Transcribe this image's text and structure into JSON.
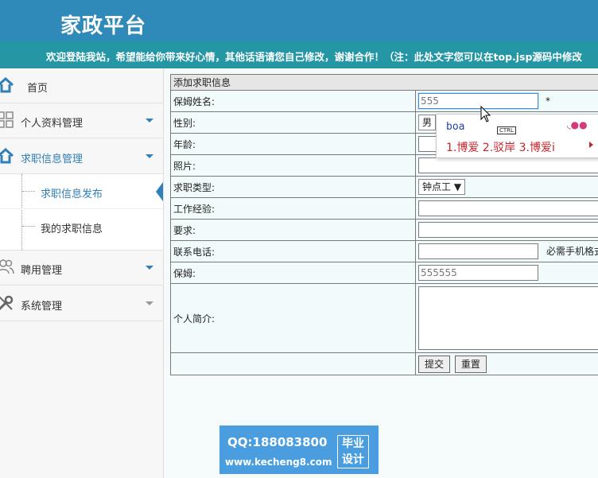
{
  "header": {
    "brand": "家政平台"
  },
  "marquee": {
    "text": "欢迎登陆我站，希望能给你带来好心情，其他话语请您自己修改，谢谢合作！（注：此处文字您可以在top.jsp源码中修改"
  },
  "sidebar": {
    "home": "首页",
    "profile": "个人资料管理",
    "jobs": "求职信息管理",
    "jobs_sub": [
      "求职信息发布",
      "我的求职信息"
    ],
    "hire": "聘用管理",
    "system": "系统管理"
  },
  "form": {
    "title": "添加求职信息",
    "name_label": "保姆姓名:",
    "name_value": "555",
    "required_mark": "*",
    "gender_label": "性别:",
    "gender_value": "男",
    "age_label": "年龄:",
    "photo_label": "照片:",
    "type_label": "求职类型:",
    "type_value": "钟点工",
    "exp_label": "工作经验:",
    "req_label": "要求:",
    "phone_label": "联系电话:",
    "phone_note": "必需手机格式",
    "nanny_label": "保姆:",
    "nanny_value": "555555",
    "intro_label": "个人简介:",
    "submit": "提交",
    "reset": "重置"
  },
  "ime": {
    "composition": "boa",
    "ctrl": "CTRL",
    "candidates": "1.博爱 2.驳岸 3.博爱i"
  },
  "watermark": {
    "qq": "QQ:188083800",
    "site": "www.kecheng8.com",
    "badge_line1": "毕业",
    "badge_line2": "设计"
  },
  "colors": {
    "header": "#2f8ab9",
    "marquee": "#2596a4",
    "accent": "#2f7fb8"
  }
}
